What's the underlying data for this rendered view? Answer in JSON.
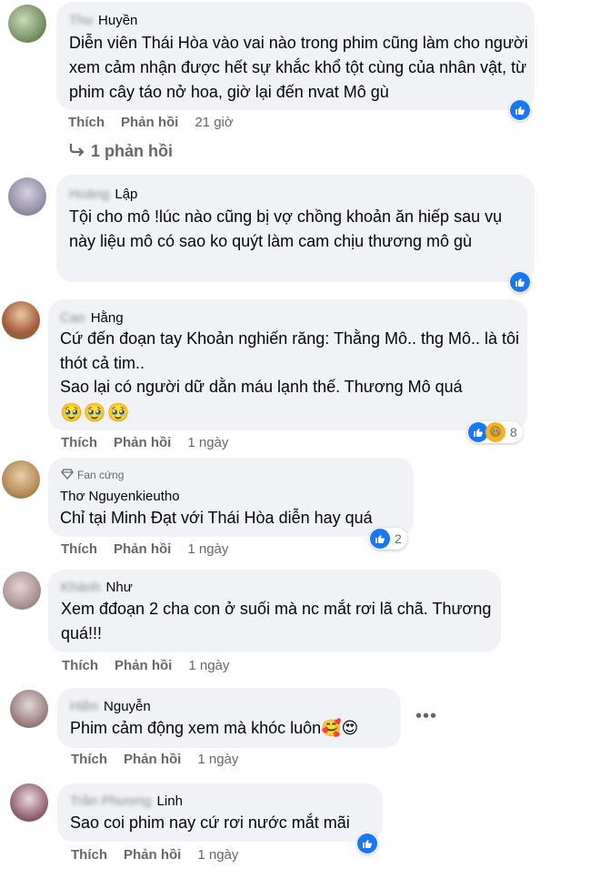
{
  "comments": [
    {
      "name_blur": "Thu",
      "name": "Huyền",
      "text": "Diễn viên Thái Hòa vào vai nào trong phim cũng làm cho người xem cảm nhận được hết sự khắc khổ tột cùng của nhân vật, từ phim cây táo nở hoa, giờ lại đến nvat Mô gù",
      "actions": {
        "like": "Thích",
        "reply": "Phản hồi",
        "time": "21 giờ"
      },
      "replies_label": "1 phản hồi"
    },
    {
      "name_blur": "Hoàng",
      "name": "Lập",
      "text": "Tội cho mô !lúc nào cũng bị vợ chồng khoản ăn hiếp sau vụ này liệu mô có sao ko quýt làm cam chịu thương mô gù"
    },
    {
      "name_blur": "Cao",
      "name": "Hằng",
      "text_lines": [
        "Cứ đến đoạn tay Khoản nghiến răng: Thằng Mô.. thg Mô.. là tôi thót cả tim..",
        "Sao lại có người dữ dằn máu lạnh thế. Thương Mô quá"
      ],
      "emojis": "🥹🥹🥹",
      "actions": {
        "like": "Thích",
        "reply": "Phản hồi",
        "time": "1 ngày"
      },
      "reaction_count": "8"
    },
    {
      "badge": "Fan cứng",
      "name": "Thơ Nguyenkieutho",
      "text": "Chỉ tại Minh Đạt với Thái Hòa diễn hay quá",
      "actions": {
        "like": "Thích",
        "reply": "Phản hồi",
        "time": "1 ngày"
      },
      "reaction_count": "2"
    },
    {
      "name_blur": "Khánh",
      "name": "Như",
      "text": "Xem đđoạn 2 cha con ở suối mà nc mắt rơi lã chã. Thương quá!!!",
      "actions": {
        "like": "Thích",
        "reply": "Phản hồi",
        "time": "1 ngày"
      }
    },
    {
      "name_blur": "Hiền",
      "name": "Nguyễn",
      "text": "Phim cảm động xem mà khóc luôn🥰😍",
      "actions": {
        "like": "Thích",
        "reply": "Phản hồi",
        "time": "1 ngày"
      }
    },
    {
      "name_blur": "Trần Phương",
      "name": "Linh",
      "text": "Sao coi phim nay cứ rơi nước mắt mãi",
      "actions": {
        "like": "Thích",
        "reply": "Phản hồi",
        "time": "1 ngày"
      }
    }
  ],
  "colors": {
    "bubble": "#f0f2f5",
    "like_blue": "#1877f2",
    "meta_gray": "#65676b"
  },
  "icons": {
    "like": "like-icon",
    "haha": "haha-icon",
    "reply_arrow": "reply-arrow-icon",
    "diamond": "diamond-icon",
    "more": "more-icon"
  }
}
